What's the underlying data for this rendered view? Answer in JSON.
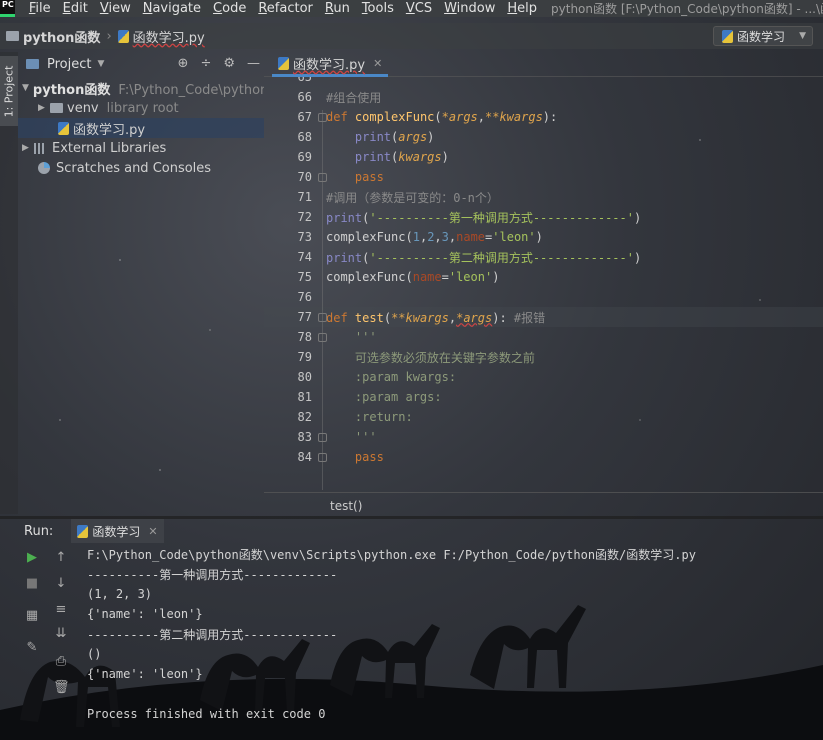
{
  "menubar": {
    "logo": "PC",
    "items": [
      "File",
      "Edit",
      "View",
      "Navigate",
      "Code",
      "Refactor",
      "Run",
      "Tools",
      "VCS",
      "Window",
      "Help"
    ],
    "title": "python函数 [F:\\Python_Code\\python函数] - ...\\函数学习"
  },
  "navbar": {
    "project": "python函数",
    "file": "函数学习.py",
    "run_config": "函数学习"
  },
  "left_strip": {
    "tab_label": "1: Project"
  },
  "project_panel": {
    "title": "Project",
    "tree": [
      {
        "label": "python函数",
        "extra": "F:\\Python_Code\\python函数"
      },
      {
        "label": "venv",
        "extra": "library root"
      },
      {
        "label": "函数学习.py",
        "extra": ""
      },
      {
        "label": "External Libraries",
        "extra": ""
      },
      {
        "label": "Scratches and Consoles",
        "extra": ""
      }
    ]
  },
  "editor": {
    "tab": "函数学习.py",
    "lines": {
      "l65": "65",
      "l66": {
        "num": "66",
        "t": "#组合使用"
      },
      "l67": {
        "num": "67",
        "def": "def",
        "name": "complexFunc",
        "p1": "(",
        "a1": "*args",
        "comma": ",",
        "a2": "**kwargs",
        "p2": "):"
      },
      "l68": {
        "num": "68",
        "fn": "print",
        "o": "(",
        "arg": "args",
        "c": ")"
      },
      "l69": {
        "num": "69",
        "fn": "print",
        "o": "(",
        "arg": "kwargs",
        "c": ")"
      },
      "l70": {
        "num": "70",
        "kw": "pass"
      },
      "l71": {
        "num": "71",
        "t": "#调用（参数是可变的：0-n个）"
      },
      "l72": {
        "num": "72",
        "fn": "print",
        "o": "(",
        "s": "'----------第一种调用方式-------------'",
        "c": ")"
      },
      "l73": {
        "num": "73",
        "fn": "complexFunc",
        "o": "(",
        "n1": "1",
        "s1": ",",
        "n2": "2",
        "s2": ",",
        "n3": "3",
        "s3": ",",
        "k": "name",
        "eq": "=",
        "s": "'leon'",
        "c": ")"
      },
      "l74": {
        "num": "74",
        "fn": "print",
        "o": "(",
        "s": "'----------第二种调用方式-------------'",
        "c": ")"
      },
      "l75": {
        "num": "75",
        "fn": "complexFunc",
        "o": "(",
        "k": "name",
        "eq": "=",
        "s": "'leon'",
        "c": ")"
      },
      "l76": {
        "num": "76"
      },
      "l77": {
        "num": "77",
        "def": "def",
        "name": "test",
        "p1": "(",
        "a1": "**kwargs",
        "comma": ",",
        "a2": "*args",
        "p2": "):",
        "cm": "#报错"
      },
      "l78": {
        "num": "78",
        "t": "'''"
      },
      "l79": {
        "num": "79",
        "t": "可选参数必须放在关键字参数之前"
      },
      "l80": {
        "num": "80",
        "t": ":param kwargs:"
      },
      "l81": {
        "num": "81",
        "t": ":param args:"
      },
      "l82": {
        "num": "82",
        "t": ":return:"
      },
      "l83": {
        "num": "83",
        "t": "'''"
      },
      "l84": {
        "num": "84",
        "kw": "pass"
      }
    },
    "breadcrumb": "test()"
  },
  "run_panel": {
    "label": "Run:",
    "tab": "函数学习",
    "console": [
      "F:\\Python_Code\\python函数\\venv\\Scripts\\python.exe F:/Python_Code/python函数/函数学习.py",
      "----------第一种调用方式-------------",
      "(1, 2, 3)",
      "{'name': 'leon'}",
      "----------第二种调用方式-------------",
      "()",
      "{'name': 'leon'}",
      "",
      "Process finished with exit code 0"
    ]
  },
  "colors": {
    "keyword": "#cc7832",
    "function": "#ffc66d",
    "string": "#a5c25c",
    "param": "#e0a54c",
    "comment": "#8a8a8a",
    "number": "#6897bb",
    "selection": "#2f425e",
    "run_green": "#4caf50"
  }
}
